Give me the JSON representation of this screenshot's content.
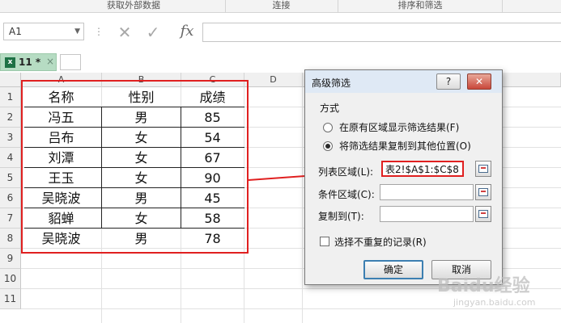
{
  "ribbon": {
    "groups": [
      "获取外部数据",
      "连接",
      "排序和筛选"
    ]
  },
  "formula_bar": {
    "name_box": "A1",
    "separator_glyph": "⋮",
    "cancel_glyph": "✕",
    "enter_glyph": "✓",
    "fx_label": "fx",
    "value": ""
  },
  "sheet_tab": {
    "icon_text": "x",
    "label": "11 *",
    "close_glyph": "×"
  },
  "grid": {
    "columns": [
      "A",
      "B",
      "C",
      "D"
    ],
    "rows": [
      "1",
      "2",
      "3",
      "4",
      "5",
      "6",
      "7",
      "8",
      "9",
      "10",
      "11"
    ],
    "table": [
      [
        "名称",
        "性别",
        "成绩"
      ],
      [
        "冯五",
        "男",
        "85"
      ],
      [
        "吕布",
        "女",
        "54"
      ],
      [
        "刘潭",
        "女",
        "67"
      ],
      [
        "王玉",
        "女",
        "90"
      ],
      [
        "吴晓波",
        "男",
        "45"
      ],
      [
        "貂蝉",
        "女",
        "58"
      ],
      [
        "吴晓波",
        "男",
        "78"
      ]
    ]
  },
  "dialog": {
    "title": "高级筛选",
    "help_glyph": "?",
    "close_glyph": "✕",
    "section": "方式",
    "option_in_place": "在原有区域显示筛选结果(F)",
    "option_copy": "将筛选结果复制到其他位置(O)",
    "option_copy_selected": true,
    "list_range_label": "列表区域(L):",
    "list_range_value": "表2!$A$1:$C$8",
    "criteria_range_label": "条件区域(C):",
    "criteria_range_value": "",
    "copy_to_label": "复制到(T):",
    "copy_to_value": "",
    "unique_label": "选择不重复的记录(R)",
    "unique_checked": false,
    "ok_label": "确定",
    "cancel_label": "取消"
  },
  "watermark": {
    "text": "Baidu经验",
    "sub": "jingyan.baidu.com"
  },
  "colors": {
    "annotation_red": "#e02020",
    "tab_green": "#b6dcc3",
    "excel_green": "#1e7145",
    "primary_button_border": "#3c7fb1"
  }
}
